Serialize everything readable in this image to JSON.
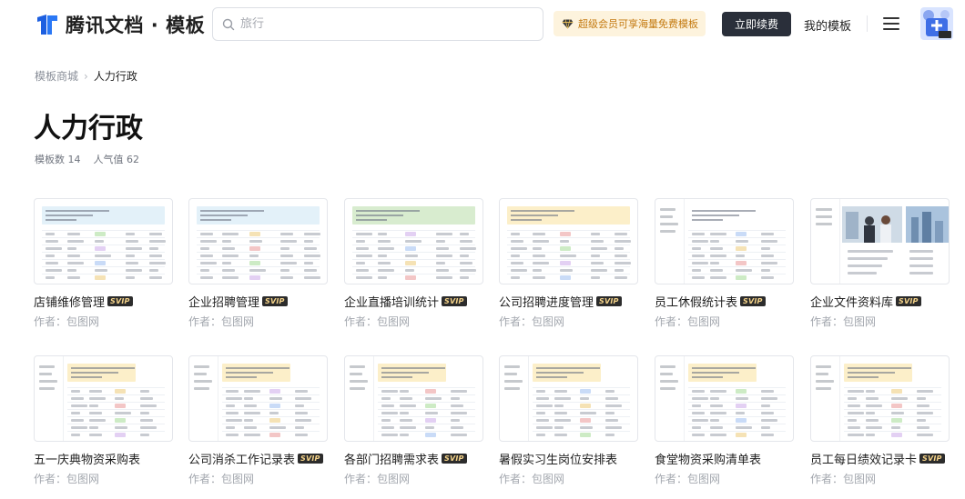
{
  "header": {
    "logo_text": "腾讯文档 · 模板",
    "search_placeholder": "旅行",
    "vip_banner": "超级会员可享海量免费模板",
    "renew_button": "立即续费",
    "my_templates": "我的模板",
    "brand_color": "#1d5fe0"
  },
  "breadcrumb": {
    "parent": "模板商城",
    "current": "人力行政"
  },
  "page": {
    "title": "人力行政",
    "template_count": "模板数 14",
    "popularity": "人气值 62"
  },
  "cards": [
    {
      "title": "店铺维修管理",
      "svip": "SVIP",
      "author": "作者：包图网",
      "note_color": "#e3f1f9",
      "style": "sheet"
    },
    {
      "title": "企业招聘管理",
      "svip": "SVIP",
      "author": "作者：包图网",
      "note_color": "#e3f1f9",
      "style": "sheet"
    },
    {
      "title": "企业直播培训统计",
      "svip": "SVIP",
      "author": "作者：包图网",
      "note_color": "#d8eccf",
      "style": "sheet"
    },
    {
      "title": "公司招聘进度管理",
      "svip": "SVIP",
      "author": "作者：包图网",
      "note_color": "#fcefc9",
      "style": "sheet"
    },
    {
      "title": "员工休假统计表",
      "svip": "SVIP",
      "author": "作者：包图网",
      "note_color": "#ffffff",
      "style": "sidebar"
    },
    {
      "title": "企业文件资料库",
      "svip": "SVIP",
      "author": "作者：包图网",
      "note_color": "#ffffff",
      "style": "photo"
    },
    {
      "title": "五一庆典物资采购表",
      "svip": "",
      "author": "作者：包图网",
      "note_color": "#fcefc9",
      "style": "sidebar"
    },
    {
      "title": "公司消杀工作记录表",
      "svip": "SVIP",
      "author": "作者：包图网",
      "note_color": "#fcefc9",
      "style": "sidebar"
    },
    {
      "title": "各部门招聘需求表",
      "svip": "SVIP",
      "author": "作者：包图网",
      "note_color": "#fcefc9",
      "style": "sidebar"
    },
    {
      "title": "暑假实习生岗位安排表",
      "svip": "",
      "author": "作者：包图网",
      "note_color": "#fcefc9",
      "style": "sidebar"
    },
    {
      "title": "食堂物资采购清单表",
      "svip": "",
      "author": "作者：包图网",
      "note_color": "#fcefc9",
      "style": "sidebar"
    },
    {
      "title": "员工每日绩效记录卡",
      "svip": "SVIP",
      "author": "作者：包图网",
      "note_color": "#fcefc9",
      "style": "sidebar"
    }
  ]
}
